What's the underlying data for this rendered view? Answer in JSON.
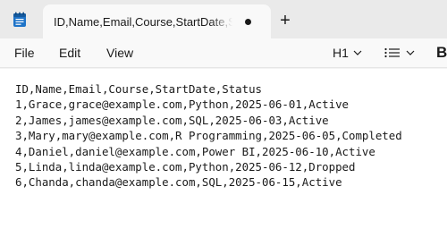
{
  "window": {
    "app_icon": "notepad-icon",
    "tab_title": "ID,Name,Email,Course,StartDate,Status",
    "new_tab_label": "+"
  },
  "menu": {
    "file": "File",
    "edit": "Edit",
    "view": "View",
    "heading_value": "H1",
    "list_icon": "bulleted-list-icon",
    "bold_label": "B"
  },
  "editor": {
    "lines": [
      "ID,Name,Email,Course,StartDate,Status",
      "1,Grace,grace@example.com,Python,2025-06-01,Active",
      "2,James,james@example.com,SQL,2025-06-03,Active",
      "3,Mary,mary@example.com,R Programming,2025-06-05,Completed",
      "4,Daniel,daniel@example.com,Power BI,2025-06-10,Active",
      "5,Linda,linda@example.com,Python,2025-06-12,Dropped",
      "6,Chanda,chanda@example.com,SQL,2025-06-15,Active"
    ]
  }
}
